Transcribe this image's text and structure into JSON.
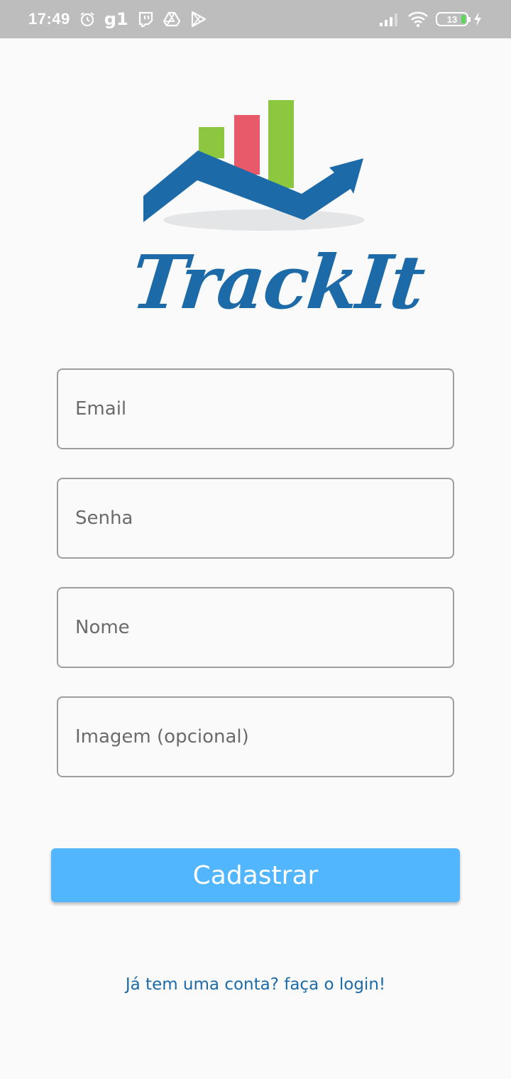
{
  "status_bar": {
    "time": "17:49",
    "app_badge": "g1",
    "battery_level": "13",
    "icons": [
      "alarm-icon",
      "g1-icon",
      "twitch-icon",
      "drive-icon",
      "play-icon",
      "signal-icon",
      "wifi-icon",
      "battery-icon",
      "charging-icon"
    ]
  },
  "logo": {
    "text": "TrackIt",
    "colors": {
      "bar_green": "#8dc63f",
      "bar_red": "#e85a6a",
      "arrow_blue": "#1c6aa8",
      "shadow": "#e3e5e6"
    }
  },
  "form": {
    "email_placeholder": "Email",
    "password_placeholder": "Senha",
    "name_placeholder": "Nome",
    "image_placeholder": "Imagem (opcional)"
  },
  "submit_label": "Cadastrar",
  "login_link": "Já tem uma conta? faça o login!",
  "colors": {
    "accent": "#52b6ff",
    "link": "#1c6aa8",
    "background": "#fafafa"
  }
}
